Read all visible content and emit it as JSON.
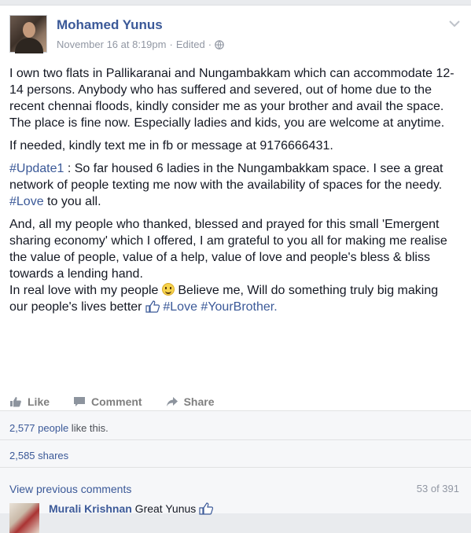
{
  "post": {
    "author": "Mohamed Yunus",
    "date": "November 16 at 8:19pm",
    "edited": "Edited",
    "paragraph1": "I own two flats in Pallikaranai and Nungambakkam which can accommodate 12-14 persons. Anybody who has suffered and severed, out of home due to the recent chennai floods, kindly consider me as your brother and avail the space.",
    "paragraph1b": "The place is fine now. Especially ladies and kids, you are welcome at anytime.",
    "paragraph2": "If needed, kindly text me in fb or message at 9176666431.",
    "update_tag": "#Update1",
    "paragraph3": " : So far housed 6 ladies in the Nungambakkam space. I see a great network of people texting me now with the availability of spaces for the needy. ",
    "love_tag": "#Love",
    "paragraph3_end": " to you all.",
    "paragraph4": "And, all my people who thanked, blessed and prayed for this small 'Emergent sharing economy' which I offered, I am grateful to you all for making me realise the value of people, value of a help, value of love and people's bless & bliss towards a lending hand.",
    "paragraph5a": "In real love with my people ",
    "paragraph5b": " Believe me, Will do something truly big making our people's lives better ",
    "paragraph5_love": " #Love ",
    "paragraph5_tag": "#YourBrother."
  },
  "actions": {
    "like": "Like",
    "comment": "Comment",
    "share": "Share"
  },
  "stats": {
    "likes_count": "2,577 people",
    "likes_suffix": " like this.",
    "shares": "2,585 shares"
  },
  "comments": {
    "view_previous": "View previous comments",
    "count": "53 of 391",
    "first_name": "Murali Krishnan",
    "first_text": " Great Yunus "
  },
  "colors": {
    "link": "#3b5998",
    "muted": "#9197a3",
    "background": "#e9ebee"
  }
}
